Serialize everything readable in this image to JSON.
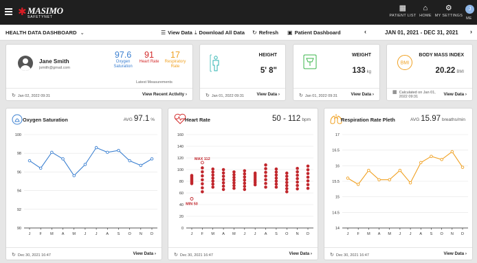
{
  "topbar": {
    "logo_word": "MASIMO",
    "logo_sub": "SAFETYNET",
    "nav": [
      {
        "label": "PATIENT LIST",
        "icon": "grid-icon"
      },
      {
        "label": "HOME",
        "icon": "home-icon"
      },
      {
        "label": "MY SETTINGS",
        "icon": "gear-icon"
      }
    ],
    "me_initial": "J",
    "me_label": "ME"
  },
  "toolbar": {
    "title": "HEALTH DATA DASHBOARD",
    "view_data": "View Data",
    "download": "Download All Data",
    "refresh": "Refresh",
    "patient_dashboard": "Patient Dashboard",
    "date_range": "JAN 01, 2021 - DEC 31, 2021"
  },
  "profile": {
    "name": "Jane Smith",
    "email": "jsmith@gmail.com",
    "vitals": [
      {
        "value": "97.6",
        "label": "Oxygen Saturation",
        "color": "#3a7fd0"
      },
      {
        "value": "91",
        "label": "Heart Rate",
        "color": "#d32a2a"
      },
      {
        "value": "17",
        "label": "Respiratory Rate",
        "color": "#f0a020"
      }
    ],
    "latest": "Latest Measurements",
    "timestamp": "Jan 02, 2022 09:31",
    "action": "View Recent Activity"
  },
  "height": {
    "label": "HEIGHT",
    "value": "5' 8\"",
    "unit": "",
    "timestamp": "Jan 01, 2022 09:31",
    "action": "View Data"
  },
  "weight": {
    "label": "WEIGHT",
    "value": "133",
    "unit": "kg",
    "timestamp": "Jan 01, 2022 09:31",
    "action": "View Data"
  },
  "bmi": {
    "label": "BODY MASS INDEX",
    "value": "20.22",
    "unit": "BMI",
    "icon_text": "BMI",
    "timestamp": "Calculated on Jan 01, 2022 09:31",
    "action": "View Data"
  },
  "spo2_card": {
    "title": "Oxygen Saturation",
    "stat_prefix": "AVG",
    "stat": "97.1",
    "stat_unit": "%",
    "timestamp": "Dec 30, 2021 16:47",
    "action": "View Data"
  },
  "hr_card": {
    "title": "Heart Rate",
    "stat": "50 - 112",
    "stat_unit": "bpm",
    "timestamp": "Dec 30, 2021 16:47",
    "action": "View Data"
  },
  "rr_card": {
    "title": "Respiration Rate Pleth",
    "stat_prefix": "AVG",
    "stat": "15.97",
    "stat_unit": "breaths/min",
    "timestamp": "Dec 30, 2021 16:47",
    "action": "View Data"
  },
  "chart_data": [
    {
      "type": "line",
      "title": "Oxygen Saturation",
      "categories": [
        "J",
        "F",
        "M",
        "A",
        "M",
        "J",
        "J",
        "A",
        "S",
        "O",
        "N",
        "D"
      ],
      "values": [
        97.2,
        96.4,
        98.1,
        97.4,
        95.6,
        96.8,
        98.6,
        98.1,
        98.3,
        97.2,
        96.7,
        97.4
      ],
      "ylim": [
        90,
        100
      ],
      "yticks": [
        90,
        92,
        94,
        96,
        98,
        100
      ],
      "color": "#3a7fd0",
      "grid": true
    },
    {
      "type": "scatter",
      "title": "Heart Rate",
      "categories": [
        "J",
        "F",
        "M",
        "A",
        "M",
        "J",
        "J",
        "A",
        "S",
        "O",
        "N",
        "D"
      ],
      "ranges": [
        [
          76,
          90
        ],
        [
          62,
          103
        ],
        [
          70,
          101
        ],
        [
          66,
          100
        ],
        [
          68,
          96
        ],
        [
          66,
          98
        ],
        [
          74,
          94
        ],
        [
          70,
          108
        ],
        [
          70,
          101
        ],
        [
          62,
          94
        ],
        [
          67,
          102
        ],
        [
          68,
          106
        ]
      ],
      "ylim": [
        0,
        160
      ],
      "yticks": [
        0,
        20,
        40,
        60,
        80,
        100,
        120,
        140,
        160
      ],
      "annotations": [
        {
          "label": "MAX 112",
          "month": "F",
          "value": 112
        },
        {
          "label": "MIN 50",
          "month": "J",
          "value": 50
        }
      ],
      "color": "#c1272d",
      "grid": true
    },
    {
      "type": "line",
      "title": "Respiration Rate Pleth",
      "categories": [
        "J",
        "F",
        "M",
        "A",
        "M",
        "J",
        "J",
        "A",
        "S",
        "O",
        "N",
        "D"
      ],
      "values": [
        15.6,
        15.4,
        15.85,
        15.55,
        15.55,
        15.85,
        15.45,
        16.1,
        16.3,
        16.2,
        16.45,
        15.95
      ],
      "ylim": [
        14,
        17
      ],
      "yticks": [
        14,
        14.5,
        15,
        15.5,
        16,
        16.5,
        17
      ],
      "color": "#f0a020",
      "grid": true
    }
  ]
}
